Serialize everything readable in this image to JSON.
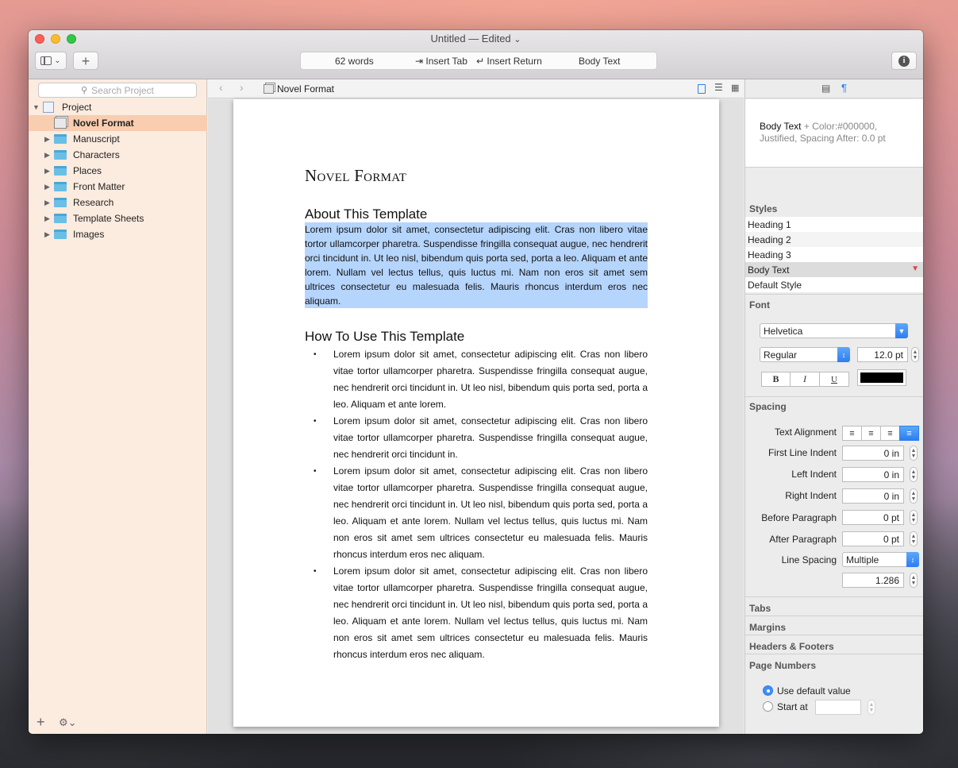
{
  "window": {
    "title": "Untitled",
    "edited": "— Edited",
    "edited_chevron": "⌄"
  },
  "toolbar": {
    "sidebar_chevron": "⌄",
    "add_label": "+",
    "word_count": "62 words",
    "insert_tab": "⇥ Insert Tab",
    "insert_return": "↵ Insert Return",
    "current_style": "Body Text",
    "info_label": "i"
  },
  "binder": {
    "search_placeholder": "Search Project",
    "project_label": "Project",
    "items": [
      {
        "label": "Novel Format",
        "icon": "template-sheet-icon"
      },
      {
        "label": "Manuscript",
        "icon": "folder-icon"
      },
      {
        "label": "Characters",
        "icon": "folder-icon"
      },
      {
        "label": "Places",
        "icon": "folder-icon"
      },
      {
        "label": "Front Matter",
        "icon": "folder-icon"
      },
      {
        "label": "Research",
        "icon": "folder-icon"
      },
      {
        "label": "Template Sheets",
        "icon": "folder-icon"
      },
      {
        "label": "Images",
        "icon": "folder-icon"
      }
    ],
    "add_label": "+",
    "gear_label": "⚙⌄"
  },
  "editor": {
    "header_title": "Novel Format",
    "doc_title": "Novel Format",
    "section1_heading": "About This Template",
    "section1_body": "Lorem ipsum dolor sit amet, consectetur adipiscing elit. Cras non libero vitae tortor ullamcorper pharetra. Suspendisse fringilla consequat augue, nec hendrerit orci tincidunt in. Ut leo nisl, bibendum quis porta sed, porta a leo. Aliquam et ante lorem. Nullam vel lectus tellus, quis luctus mi. Nam non eros sit amet sem ultrices consectetur eu malesuada felis. Mauris rhoncus interdum eros nec aliquam.",
    "section2_heading": "How To Use This Template",
    "bullets": [
      "Lorem ipsum dolor sit amet, consectetur adipiscing elit. Cras non libero vitae tortor ullamcorper pharetra. Suspendisse fringilla consequat augue, nec hendrerit orci tincidunt in. Ut leo nisl, bibendum quis porta sed, porta a leo. Aliquam et ante lorem.",
      "Lorem ipsum dolor sit amet, consectetur adipiscing elit. Cras non libero vitae tortor ullamcorper pharetra. Suspendisse fringilla consequat augue, nec hendrerit orci tincidunt in.",
      "Lorem ipsum dolor sit amet, consectetur adipiscing elit. Cras non libero vitae tortor ullamcorper pharetra. Suspendisse fringilla consequat augue, nec hendrerit orci tincidunt in. Ut leo nisl, bibendum quis porta sed, porta a leo. Aliquam et ante lorem. Nullam vel lectus tellus, quis luctus mi. Nam non eros sit amet sem ultrices consectetur eu malesuada felis. Mauris rhoncus interdum eros nec aliquam.",
      "Lorem ipsum dolor sit amet, consectetur adipiscing elit. Cras non libero vitae tortor ullamcorper pharetra. Suspendisse fringilla consequat augue, nec hendrerit orci tincidunt in. Ut leo nisl, bibendum quis porta sed, porta a leo. Aliquam et ante lorem. Nullam vel lectus tellus, quis luctus mi. Nam non eros sit amet sem ultrices consectetur eu malesuada felis. Mauris rhoncus interdum eros nec aliquam."
    ]
  },
  "inspector": {
    "style_preview_name": "Body Text",
    "style_preview_detail": "+ Color:#000000, Justified, Spacing After: 0.0 pt",
    "styles_title": "Styles",
    "styles": [
      "Heading 1",
      "Heading 2",
      "Heading 3",
      "Body Text",
      "Default Style"
    ],
    "selected_style_index": 3,
    "font_title": "Font",
    "font_family": "Helvetica",
    "font_face": "Regular",
    "font_size": "12.0 pt",
    "bold_label": "B",
    "italic_label": "I",
    "underline_label": "U",
    "text_color": "#000000",
    "spacing_title": "Spacing",
    "text_alignment_label": "Text Alignment",
    "alignments": [
      "left",
      "center",
      "right",
      "justify"
    ],
    "active_alignment": "justify",
    "first_line_indent_label": "First Line Indent",
    "first_line_indent": "0 in",
    "left_indent_label": "Left Indent",
    "left_indent": "0 in",
    "right_indent_label": "Right Indent",
    "right_indent": "0 in",
    "before_paragraph_label": "Before Paragraph",
    "before_paragraph": "0 pt",
    "after_paragraph_label": "After Paragraph",
    "after_paragraph": "0 pt",
    "line_spacing_label": "Line Spacing",
    "line_spacing_mode": "Multiple",
    "line_spacing_value": "1.286",
    "tabs_title": "Tabs",
    "margins_title": "Margins",
    "headers_footers_title": "Headers & Footers",
    "page_numbers_title": "Page Numbers",
    "use_default_label": "Use default value",
    "start_at_label": "Start at",
    "start_at_value": ""
  },
  "colors": {
    "accent": "#2c7ef0",
    "binder_bg": "#fcebdf",
    "binder_selected": "#f8cdb0",
    "selection_highlight": "#b5d5fd",
    "folder": "#6bbfe6"
  }
}
